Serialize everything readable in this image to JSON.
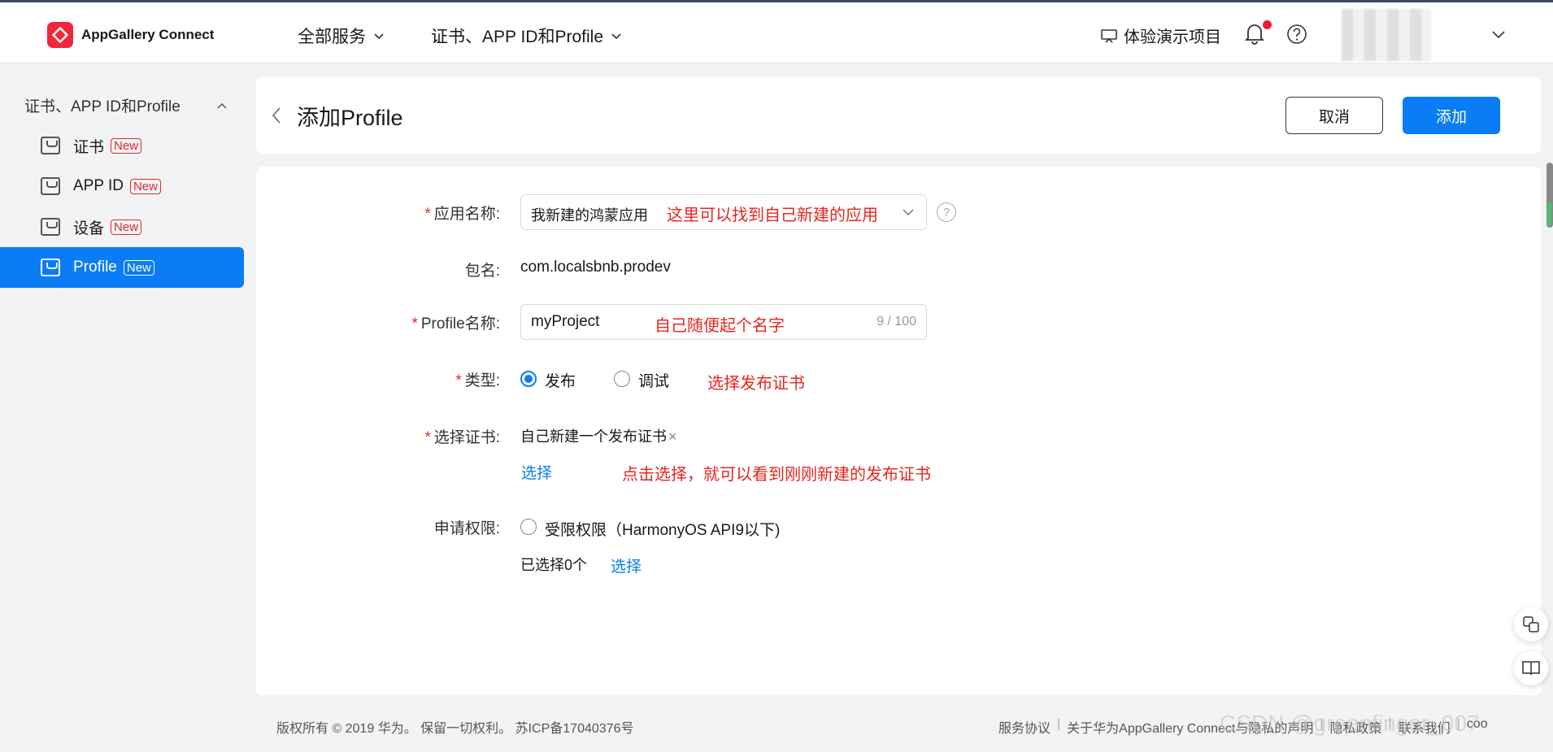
{
  "topbar": {
    "brand": "AppGallery Connect",
    "nav_all_services": "全部服务",
    "nav_cert": "证书、APP ID和Profile",
    "demo_project": "体验演示项目"
  },
  "sidebar": {
    "group_title": "证书、APP ID和Profile",
    "badge": "New",
    "items": [
      {
        "label": "证书"
      },
      {
        "label": "APP ID"
      },
      {
        "label": "设备"
      },
      {
        "label": "Profile"
      }
    ]
  },
  "header": {
    "title": "添加Profile",
    "cancel_label": "取消",
    "add_label": "添加"
  },
  "form": {
    "app_name_label": "应用名称:",
    "app_name_value": "我新建的鸿蒙应用",
    "app_name_annot": "这里可以找到自己新建的应用",
    "package_label": "包名:",
    "package_value": "com.localsbnb.prodev",
    "profile_name_label": "Profile名称:",
    "profile_name_value": "myProject",
    "profile_name_annot": "自己随便起个名字",
    "profile_name_counter": "9 / 100",
    "type_label": "类型:",
    "type_release": "发布",
    "type_debug": "调试",
    "type_annot": "选择发布证书",
    "cert_label": "选择证书:",
    "cert_value": "自己新建一个发布证书",
    "cert_select": "选择",
    "cert_annot": "点击选择，就可以看到刚刚新建的发布证书",
    "perm_label": "申请权限:",
    "perm_option": "受限权限（HarmonyOS API9以下)",
    "perm_selected": "已选择0个",
    "perm_select": "选择",
    "required_mark": "*"
  },
  "footer": {
    "copyright": "版权所有 © 2019 华为。 保留一切权利。 苏ICP备17040376号",
    "links": [
      "服务协议",
      "关于华为AppGallery Connect与隐私的声明",
      "隐私政策",
      "联系我们",
      "coo"
    ],
    "watermark": "CSDN @greenfinger_007"
  },
  "colors": {
    "accent": "#0a7cf5",
    "annotation": "#e8251f",
    "badge": "#e02b2b"
  }
}
